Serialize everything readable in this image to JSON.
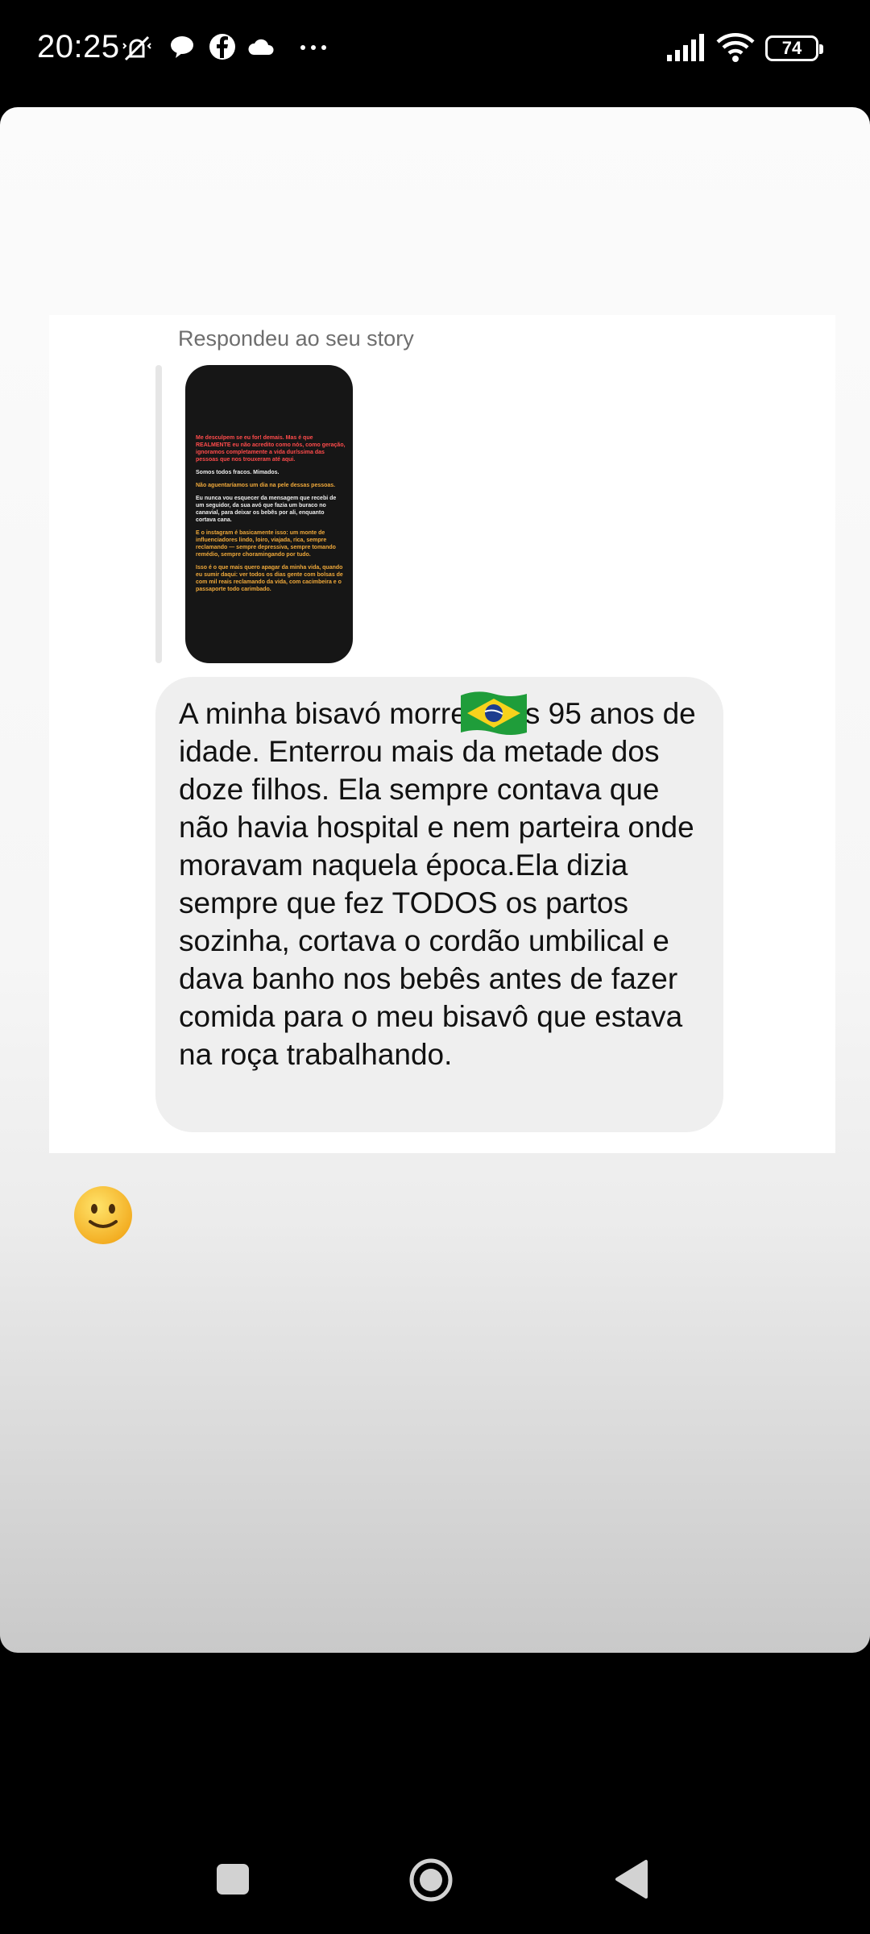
{
  "status_bar": {
    "time": "20:25",
    "battery": "74",
    "icons": [
      "mute-vibrate-icon",
      "chat-bubble-icon",
      "facebook-icon",
      "cloud-icon",
      "more-dots-icon",
      "signal-icon",
      "wifi-icon",
      "battery-icon"
    ]
  },
  "story_reply": {
    "caption": "Respondeu ao seu story",
    "story_preview_lines": [
      "Me desculpem se eu for! demais. Mas é que REALMENTE eu não acredito como nós, como geração, ignoramos completamente a vida dur/ssima das pessoas que nos trouxeram até aqui.",
      "Somos todos fracos. Mimados.",
      "Não aguentaríamos um dia na pele dessas pessoas.",
      "Eu nunca vou esquecer da mensagem que recebi de um seguidor, da sua avó que fazia um buraco no canavial, para deixar os bebês por ali, enquanto cortava cana.",
      "E o instagram é basicamente isso: um monte de influenciadores lindo, loiro, viajada, rica, sempre reclamando — sempre depressiva, sempre tomando remédio, sempre choramingando por tudo.",
      "Isso é o que mais quero apagar da minha vida, quando eu sumir daqui: ver todos os dias gente com bolsas de com mil reais reclamando da vida, com cacimbeira e o passaporte todo carimbado."
    ]
  },
  "message": {
    "text": "A minha bisavó morreu aos 95 anos de idade. Enterrou mais da metade dos doze filhos. Ela sempre contava que não havia hospital e nem parteira onde moravam naquela época.Ela dizia sempre que fez TODOS os partos sozinha, cortava o cordão umbilical e dava banho nos bebês antes de fazer comida para o meu bisavô que estava na roça trabalhando."
  },
  "colors": {
    "bubble": "#efefef",
    "caption": "#6e6e6e",
    "story_bg": "#161616",
    "highlight": "#f0a93a"
  }
}
